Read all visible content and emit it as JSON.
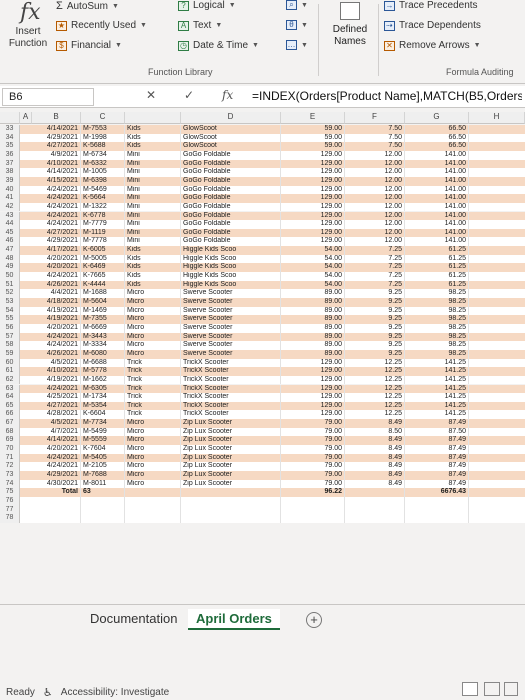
{
  "ribbon": {
    "fx_glyph": "fx",
    "insert_function": "Insert Function",
    "autosum": "AutoSum",
    "recently_used": "Recently Used",
    "financial": "Financial",
    "logical": "Logical",
    "text": "Text",
    "date_time": "Date & Time",
    "defined_names": "Defined Names",
    "trace_precedents": "Trace Precedents",
    "trace_dependents": "Trace Dependents",
    "remove_arrows": "Remove Arrows",
    "function_library_label": "Function Library",
    "formula_auditing_label": "Formula Auditing"
  },
  "formula_bar": {
    "name_box": "B6",
    "cancel": "✕",
    "enter": "✓",
    "fx": "fx",
    "formula": "=INDEX(Orders[Product Name],MATCH(B5,Orders["
  },
  "columns": [
    "A",
    "B",
    "C",
    "D",
    "E",
    "F",
    "G",
    "H"
  ],
  "rows": [
    {
      "n": "33",
      "b": "4/14/2021",
      "c": "M-7553",
      "d": "Kids",
      "e": "GlowScoot",
      "f": "59.00",
      "g": "7.50",
      "h": "66.50"
    },
    {
      "n": "34",
      "b": "4/29/2021",
      "c": "M-1998",
      "d": "Kids",
      "e": "GlowScoot",
      "f": "59.00",
      "g": "7.50",
      "h": "66.50"
    },
    {
      "n": "35",
      "b": "4/27/2021",
      "c": "K-5688",
      "d": "Kids",
      "e": "GlowScoot",
      "f": "59.00",
      "g": "7.50",
      "h": "66.50"
    },
    {
      "n": "36",
      "b": "4/9/2021",
      "c": "M-6734",
      "d": "Mini",
      "e": "GoGo Foldable",
      "f": "129.00",
      "g": "12.00",
      "h": "141.00"
    },
    {
      "n": "37",
      "b": "4/10/2021",
      "c": "M-6332",
      "d": "Mini",
      "e": "GoGo Foldable",
      "f": "129.00",
      "g": "12.00",
      "h": "141.00"
    },
    {
      "n": "38",
      "b": "4/14/2021",
      "c": "M-1005",
      "d": "Mini",
      "e": "GoGo Foldable",
      "f": "129.00",
      "g": "12.00",
      "h": "141.00"
    },
    {
      "n": "39",
      "b": "4/15/2021",
      "c": "M-6398",
      "d": "Mini",
      "e": "GoGo Foldable",
      "f": "129.00",
      "g": "12.00",
      "h": "141.00"
    },
    {
      "n": "40",
      "b": "4/24/2021",
      "c": "M-5469",
      "d": "Mini",
      "e": "GoGo Foldable",
      "f": "129.00",
      "g": "12.00",
      "h": "141.00"
    },
    {
      "n": "41",
      "b": "4/24/2021",
      "c": "K-5664",
      "d": "Mini",
      "e": "GoGo Foldable",
      "f": "129.00",
      "g": "12.00",
      "h": "141.00"
    },
    {
      "n": "42",
      "b": "4/24/2021",
      "c": "M-1322",
      "d": "Mini",
      "e": "GoGo Foldable",
      "f": "129.00",
      "g": "12.00",
      "h": "141.00"
    },
    {
      "n": "43",
      "b": "4/24/2021",
      "c": "K-6778",
      "d": "Mini",
      "e": "GoGo Foldable",
      "f": "129.00",
      "g": "12.00",
      "h": "141.00"
    },
    {
      "n": "44",
      "b": "4/24/2021",
      "c": "M-7779",
      "d": "Mini",
      "e": "GoGo Foldable",
      "f": "129.00",
      "g": "12.00",
      "h": "141.00"
    },
    {
      "n": "45",
      "b": "4/27/2021",
      "c": "M-1119",
      "d": "Mini",
      "e": "GoGo Foldable",
      "f": "129.00",
      "g": "12.00",
      "h": "141.00"
    },
    {
      "n": "46",
      "b": "4/29/2021",
      "c": "M-7778",
      "d": "Mini",
      "e": "GoGo Foldable",
      "f": "129.00",
      "g": "12.00",
      "h": "141.00"
    },
    {
      "n": "47",
      "b": "4/17/2021",
      "c": "K-6005",
      "d": "Kids",
      "e": "Higgle Kids Scoo",
      "f": "54.00",
      "g": "7.25",
      "h": "61.25"
    },
    {
      "n": "48",
      "b": "4/20/2021",
      "c": "M-5005",
      "d": "Kids",
      "e": "Higgle Kids Scoo",
      "f": "54.00",
      "g": "7.25",
      "h": "61.25"
    },
    {
      "n": "49",
      "b": "4/20/2021",
      "c": "K-6469",
      "d": "Kids",
      "e": "Higgle Kids Scoo",
      "f": "54.00",
      "g": "7.25",
      "h": "61.25"
    },
    {
      "n": "50",
      "b": "4/24/2021",
      "c": "K-7665",
      "d": "Kids",
      "e": "Higgle Kids Scoo",
      "f": "54.00",
      "g": "7.25",
      "h": "61.25"
    },
    {
      "n": "51",
      "b": "4/26/2021",
      "c": "K-4444",
      "d": "Kids",
      "e": "Higgle Kids Scoo",
      "f": "54.00",
      "g": "7.25",
      "h": "61.25"
    },
    {
      "n": "52",
      "b": "4/4/2021",
      "c": "M-1688",
      "d": "Micro",
      "e": "Swerve Scooter",
      "f": "89.00",
      "g": "9.25",
      "h": "98.25"
    },
    {
      "n": "53",
      "b": "4/18/2021",
      "c": "M-5604",
      "d": "Micro",
      "e": "Swerve Scooter",
      "f": "89.00",
      "g": "9.25",
      "h": "98.25"
    },
    {
      "n": "54",
      "b": "4/19/2021",
      "c": "M-1469",
      "d": "Micro",
      "e": "Swerve Scooter",
      "f": "89.00",
      "g": "9.25",
      "h": "98.25"
    },
    {
      "n": "55",
      "b": "4/19/2021",
      "c": "M-7355",
      "d": "Micro",
      "e": "Swerve Scooter",
      "f": "89.00",
      "g": "9.25",
      "h": "98.25"
    },
    {
      "n": "56",
      "b": "4/20/2021",
      "c": "M-6669",
      "d": "Micro",
      "e": "Swerve Scooter",
      "f": "89.00",
      "g": "9.25",
      "h": "98.25"
    },
    {
      "n": "57",
      "b": "4/24/2021",
      "c": "M-3443",
      "d": "Micro",
      "e": "Swerve Scooter",
      "f": "89.00",
      "g": "9.25",
      "h": "98.25"
    },
    {
      "n": "58",
      "b": "4/24/2021",
      "c": "M-3334",
      "d": "Micro",
      "e": "Swerve Scooter",
      "f": "89.00",
      "g": "9.25",
      "h": "98.25"
    },
    {
      "n": "59",
      "b": "4/26/2021",
      "c": "M-6080",
      "d": "Micro",
      "e": "Swerve Scooter",
      "f": "89.00",
      "g": "9.25",
      "h": "98.25"
    },
    {
      "n": "60",
      "b": "4/5/2021",
      "c": "M-6688",
      "d": "Trick",
      "e": "TrickX Scooter",
      "f": "129.00",
      "g": "12.25",
      "h": "141.25"
    },
    {
      "n": "61",
      "b": "4/10/2021",
      "c": "M-5778",
      "d": "Trick",
      "e": "TrickX Scooter",
      "f": "129.00",
      "g": "12.25",
      "h": "141.25"
    },
    {
      "n": "62",
      "b": "4/19/2021",
      "c": "M-1662",
      "d": "Trick",
      "e": "TrickX Scooter",
      "f": "129.00",
      "g": "12.25",
      "h": "141.25"
    },
    {
      "n": "63",
      "b": "4/24/2021",
      "c": "M-6305",
      "d": "Trick",
      "e": "TrickX Scooter",
      "f": "129.00",
      "g": "12.25",
      "h": "141.25"
    },
    {
      "n": "64",
      "b": "4/25/2021",
      "c": "M-1734",
      "d": "Trick",
      "e": "TrickX Scooter",
      "f": "129.00",
      "g": "12.25",
      "h": "141.25"
    },
    {
      "n": "65",
      "b": "4/27/2021",
      "c": "M-5354",
      "d": "Trick",
      "e": "TrickX Scooter",
      "f": "129.00",
      "g": "12.25",
      "h": "141.25"
    },
    {
      "n": "66",
      "b": "4/28/2021",
      "c": "K-6604",
      "d": "Trick",
      "e": "TrickX Scooter",
      "f": "129.00",
      "g": "12.25",
      "h": "141.25"
    },
    {
      "n": "67",
      "b": "4/5/2021",
      "c": "M-7734",
      "d": "Micro",
      "e": "Zip Lux Scooter",
      "f": "79.00",
      "g": "8.49",
      "h": "87.49"
    },
    {
      "n": "68",
      "b": "4/7/2021",
      "c": "M-5499",
      "d": "Micro",
      "e": "Zip Lux Scooter",
      "f": "79.00",
      "g": "8.50",
      "h": "87.50"
    },
    {
      "n": "69",
      "b": "4/14/2021",
      "c": "M-5559",
      "d": "Micro",
      "e": "Zip Lux Scooter",
      "f": "79.00",
      "g": "8.49",
      "h": "87.49"
    },
    {
      "n": "70",
      "b": "4/20/2021",
      "c": "K-7604",
      "d": "Micro",
      "e": "Zip Lux Scooter",
      "f": "79.00",
      "g": "8.49",
      "h": "87.49"
    },
    {
      "n": "71",
      "b": "4/24/2021",
      "c": "M-5405",
      "d": "Micro",
      "e": "Zip Lux Scooter",
      "f": "79.00",
      "g": "8.49",
      "h": "87.49"
    },
    {
      "n": "72",
      "b": "4/24/2021",
      "c": "M-2105",
      "d": "Micro",
      "e": "Zip Lux Scooter",
      "f": "79.00",
      "g": "8.49",
      "h": "87.49"
    },
    {
      "n": "73",
      "b": "4/29/2021",
      "c": "M-7688",
      "d": "Micro",
      "e": "Zip Lux Scooter",
      "f": "79.00",
      "g": "8.49",
      "h": "87.49"
    },
    {
      "n": "74",
      "b": "4/30/2021",
      "c": "M-8011",
      "d": "Micro",
      "e": "Zip Lux Scooter",
      "f": "79.00",
      "g": "8.49",
      "h": "87.49"
    },
    {
      "n": "75",
      "b": "Total",
      "c": "63",
      "d": "",
      "e": "",
      "f": "96.22",
      "g": "",
      "h": "6676.43"
    },
    {
      "n": "76",
      "b": "",
      "c": "",
      "d": "",
      "e": "",
      "f": "",
      "g": "",
      "h": ""
    },
    {
      "n": "77",
      "b": "",
      "c": "",
      "d": "",
      "e": "",
      "f": "",
      "g": "",
      "h": ""
    },
    {
      "n": "78",
      "b": "",
      "c": "",
      "d": "",
      "e": "",
      "f": "",
      "g": "",
      "h": ""
    }
  ],
  "sheets": {
    "documentation": "Documentation",
    "april_orders": "April Orders",
    "add": "+"
  },
  "status": {
    "ready": "Ready",
    "accessibility": "Accessibility: Investigate"
  },
  "colors": {
    "band": "#f6d9c3",
    "accent_green": "#1e6b3a"
  }
}
